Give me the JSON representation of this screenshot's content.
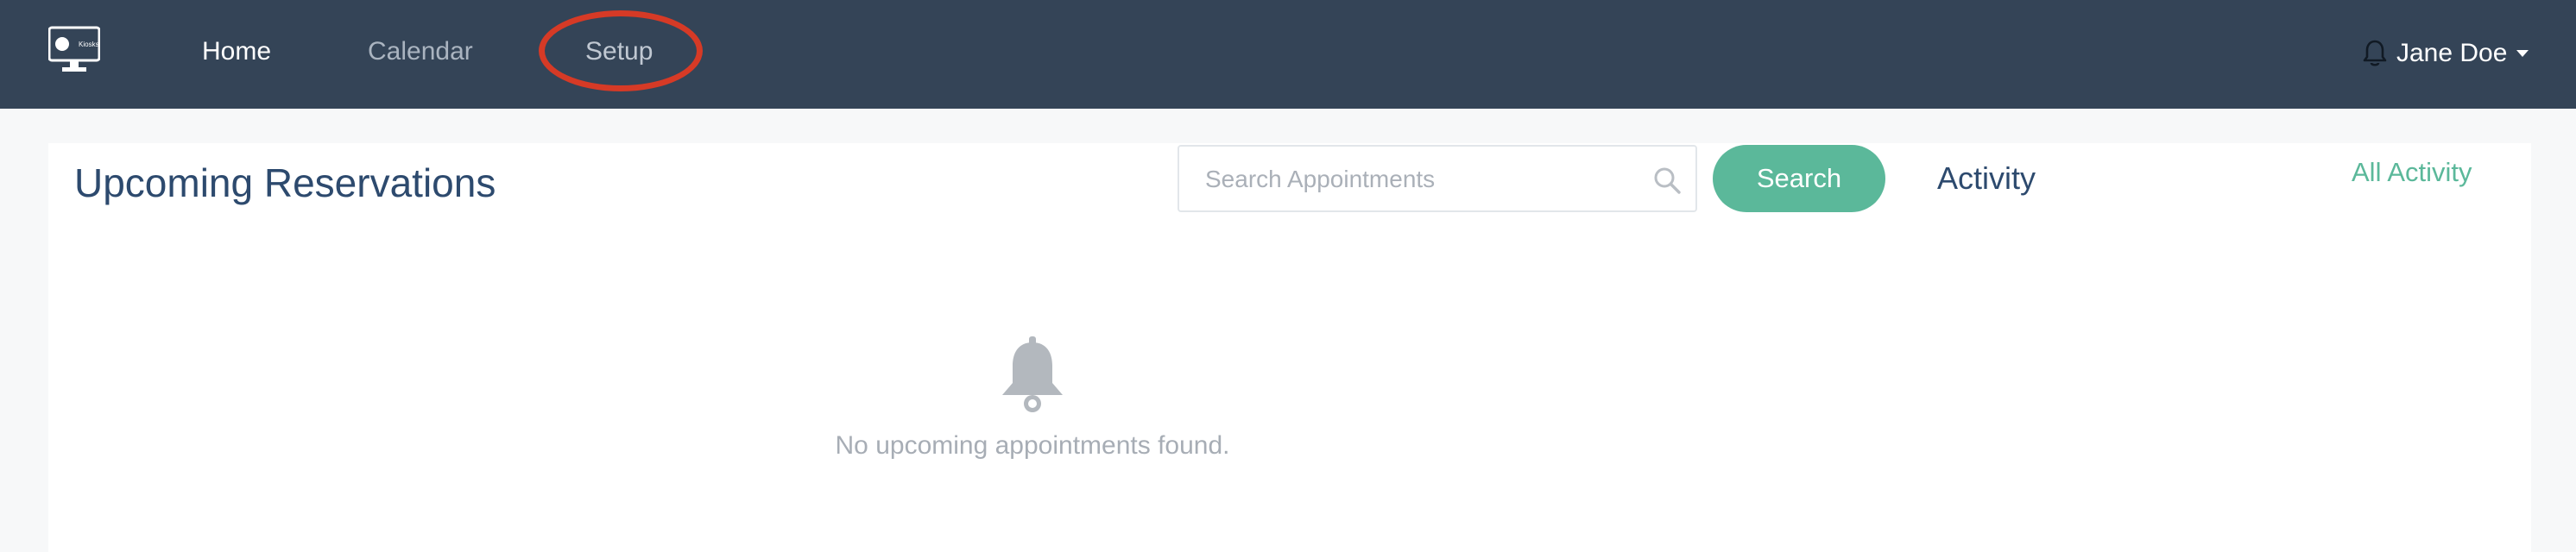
{
  "navbar": {
    "logo_text": "Kiosks",
    "items": [
      {
        "label": "Home",
        "active": true
      },
      {
        "label": "Calendar",
        "active": false
      },
      {
        "label": "Setup",
        "active": false,
        "highlighted": true
      }
    ],
    "user": {
      "name": "Jane Doe"
    }
  },
  "reservations": {
    "title": "Upcoming Reservations",
    "search": {
      "placeholder": "Search Appointments",
      "value": "",
      "button_label": "Search"
    },
    "empty_message": "No upcoming appointments found."
  },
  "activity": {
    "title": "Activity",
    "all_link": "All Activity"
  },
  "colors": {
    "navbar": "#344457",
    "accent": "#5bb89a",
    "title": "#2d4a6e",
    "highlight_ring": "#d63a26"
  }
}
